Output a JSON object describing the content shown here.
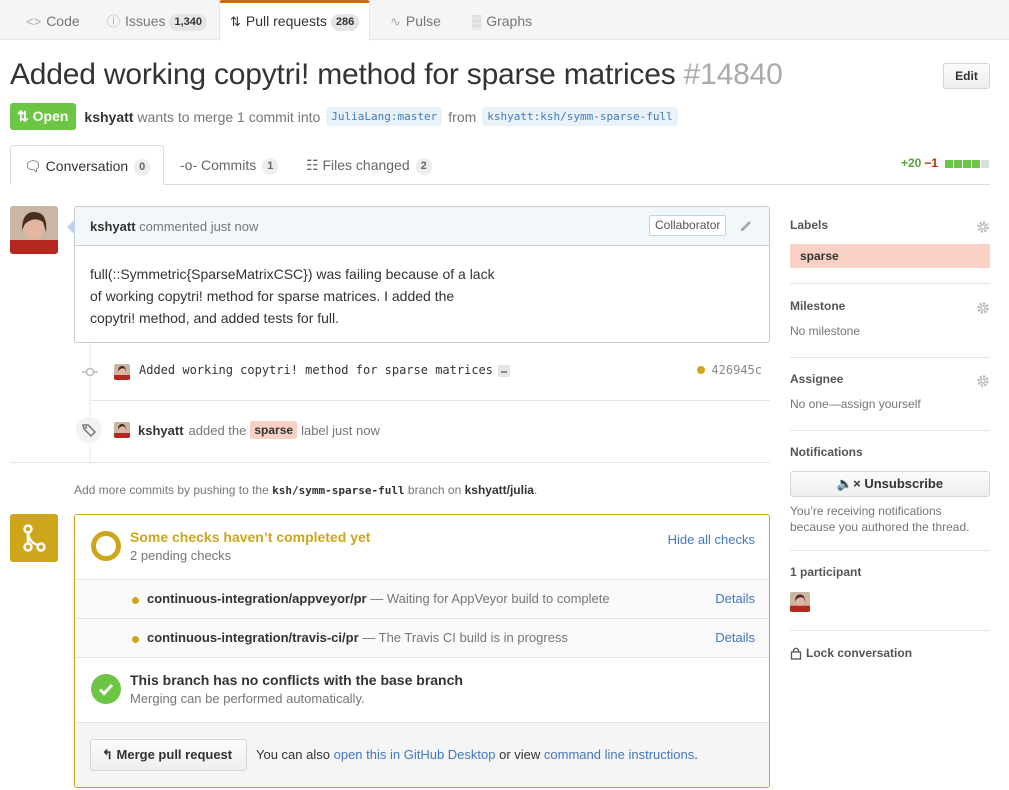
{
  "repo_nav": {
    "code": "Code",
    "issues": "Issues",
    "issues_count": "1,340",
    "pulls": "Pull requests",
    "pulls_count": "286",
    "pulse": "Pulse",
    "graphs": "Graphs"
  },
  "pr": {
    "title": "Added working copytri! method for sparse matrices",
    "number": "#14840",
    "edit_label": "Edit",
    "state": "Open",
    "author": "kshyatt",
    "meta_text": "wants to merge 1 commit into",
    "base_ref": "JuliaLang:master",
    "from_text": "from",
    "head_ref": "kshyatt:ksh/symm-sparse-full"
  },
  "tabs": [
    {
      "label": "Conversation",
      "count": "0"
    },
    {
      "label": "Commits",
      "count": "1"
    },
    {
      "label": "Files changed",
      "count": "2"
    }
  ],
  "diffstat": {
    "additions": "+20",
    "deletions": "−1"
  },
  "comment": {
    "author": "kshyatt",
    "action": "commented just now",
    "badge": "Collaborator",
    "lines": [
      "full(::Symmetric{SparseMatrixCSC}) was failing because of a lack",
      "of working copytri! method for sparse matrices. I added the",
      "copytri! method, and added tests for full."
    ]
  },
  "commit_event": {
    "message": "Added working copytri! method for sparse matrices",
    "ellipsis": "…",
    "sha": "426945c"
  },
  "label_event": {
    "author": "kshyatt",
    "pre": "added the",
    "label": "sparse",
    "post": "label just now"
  },
  "push_hint": {
    "pre": "Add more commits by pushing to the",
    "branch": "ksh/symm-sparse-full",
    "mid": "branch on",
    "repo": "kshyatt/julia",
    "post": "."
  },
  "merge": {
    "status_title": "Some checks haven’t completed yet",
    "status_sub": "2 pending checks",
    "hide_checks": "Hide all checks",
    "checks": [
      {
        "name": "continuous-integration/appveyor/pr",
        "desc": "— Waiting for AppVeyor build to complete",
        "details": "Details"
      },
      {
        "name": "continuous-integration/travis-ci/pr",
        "desc": "— The Travis CI build is in progress",
        "details": "Details"
      }
    ],
    "clean_title": "This branch has no conflicts with the base branch",
    "clean_sub": "Merging can be performed automatically.",
    "merge_button": "Merge pull request",
    "alt_pre": "You can also",
    "alt_link1": "open this in GitHub Desktop",
    "alt_mid": "or view",
    "alt_link2": "command line instructions",
    "alt_post": "."
  },
  "sidebar": {
    "labels_h": "Labels",
    "label": "sparse",
    "milestone_h": "Milestone",
    "milestone": "No milestone",
    "assignee_h": "Assignee",
    "assignee": "No one—assign yourself",
    "notifications_h": "Notifications",
    "unsubscribe": "Unsubscribe",
    "notif_line1": "You’re receiving notifications",
    "notif_line2": "because you authored the thread.",
    "participants_h": "1 participant",
    "lock": "Lock conversation"
  },
  "colors": {
    "accent_orange": "#d26911",
    "open_green": "#6cc644",
    "pending_yellow": "#cea61b",
    "label_sparse": "#f9d0c4",
    "link_blue": "#4078c0"
  }
}
